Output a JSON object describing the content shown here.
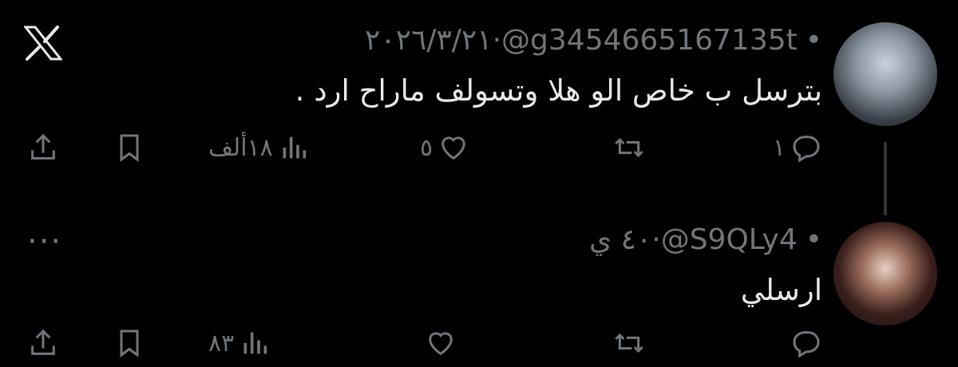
{
  "tweets": [
    {
      "handle": "@g3454665167135t",
      "date": "٢٠٢٦/٣/٢١",
      "text": "بترسل ب خاص الو هلا وتسولف ماراح ارد .",
      "replies": "١",
      "retweets": "",
      "likes": "٥",
      "views": "١٨ألف"
    },
    {
      "handle": "@S9QLy4",
      "date": "٤٠ ي",
      "text": "ارسلي",
      "replies": "",
      "retweets": "",
      "likes": "",
      "views": "٨٣"
    }
  ],
  "more_label": "···",
  "colors": {
    "background": "#000000",
    "text": "#e7e9ea",
    "muted": "#71767b"
  },
  "icons": [
    "x-logo-icon",
    "reply-icon",
    "retweet-icon",
    "like-icon",
    "views-icon",
    "bookmark-icon",
    "share-icon",
    "more-icon"
  ]
}
